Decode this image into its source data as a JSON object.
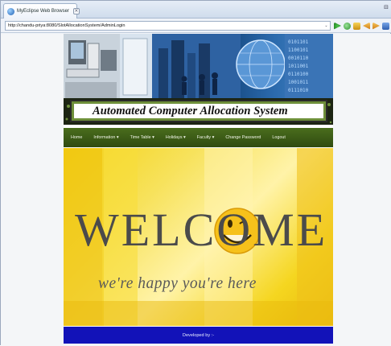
{
  "browser": {
    "tab_title": "MyEclipse Web Browser",
    "tab_close": "×",
    "window_control": "⊟",
    "url": "http://chandu-priya:8080/SlotAllocationSystem/AdminLogin",
    "url_dropdown": "⌄"
  },
  "site": {
    "title": "Automated Computer Allocation System",
    "nav": [
      {
        "label": "Home"
      },
      {
        "label": "Information ▾"
      },
      {
        "label": "Time Table ▾"
      },
      {
        "label": "Holidays ▾"
      },
      {
        "label": "Faculty ▾"
      },
      {
        "label": "Change Password"
      },
      {
        "label": "Logout"
      }
    ],
    "welcome_word": "WELCOME",
    "welcome_sub": "we're happy you're here",
    "footer": "Developed by :-"
  },
  "colors": {
    "nav_bg": "#3b5a16",
    "footer_bg": "#1212b8",
    "welcome_bg": "#f4d215"
  }
}
